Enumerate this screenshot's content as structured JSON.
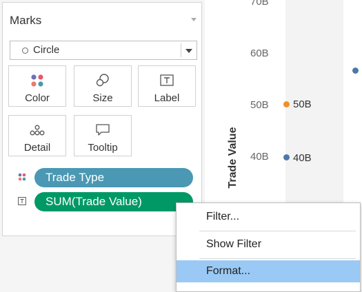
{
  "marks": {
    "title": "Marks",
    "mark_type": "Circle",
    "tiles": [
      {
        "label": "Color",
        "icon": "color-dots-icon"
      },
      {
        "label": "Size",
        "icon": "size-icon"
      },
      {
        "label": "Label",
        "icon": "label-icon"
      },
      {
        "label": "Detail",
        "icon": "detail-icon"
      },
      {
        "label": "Tooltip",
        "icon": "tooltip-icon"
      }
    ],
    "pills": [
      {
        "label": "Trade Type",
        "color": "#4a98b3",
        "icon": "color-dots-icon"
      },
      {
        "label": "SUM(Trade Value)",
        "color": "#009966",
        "icon": "label-icon"
      }
    ]
  },
  "chart": {
    "ytitle": "Trade Value",
    "ticks": [
      "70B",
      "60B",
      "50B",
      "40B"
    ],
    "points": [
      {
        "label": "50B",
        "value": 50,
        "color": "#f28e2b"
      },
      {
        "label": "40B",
        "value": 40,
        "color": "#4e79a7"
      },
      {
        "label": "",
        "value": 56,
        "color": "#4e79a7"
      }
    ]
  },
  "context_menu": {
    "items": [
      "Filter...",
      "Show Filter",
      "Format..."
    ],
    "highlighted": "Format..."
  }
}
